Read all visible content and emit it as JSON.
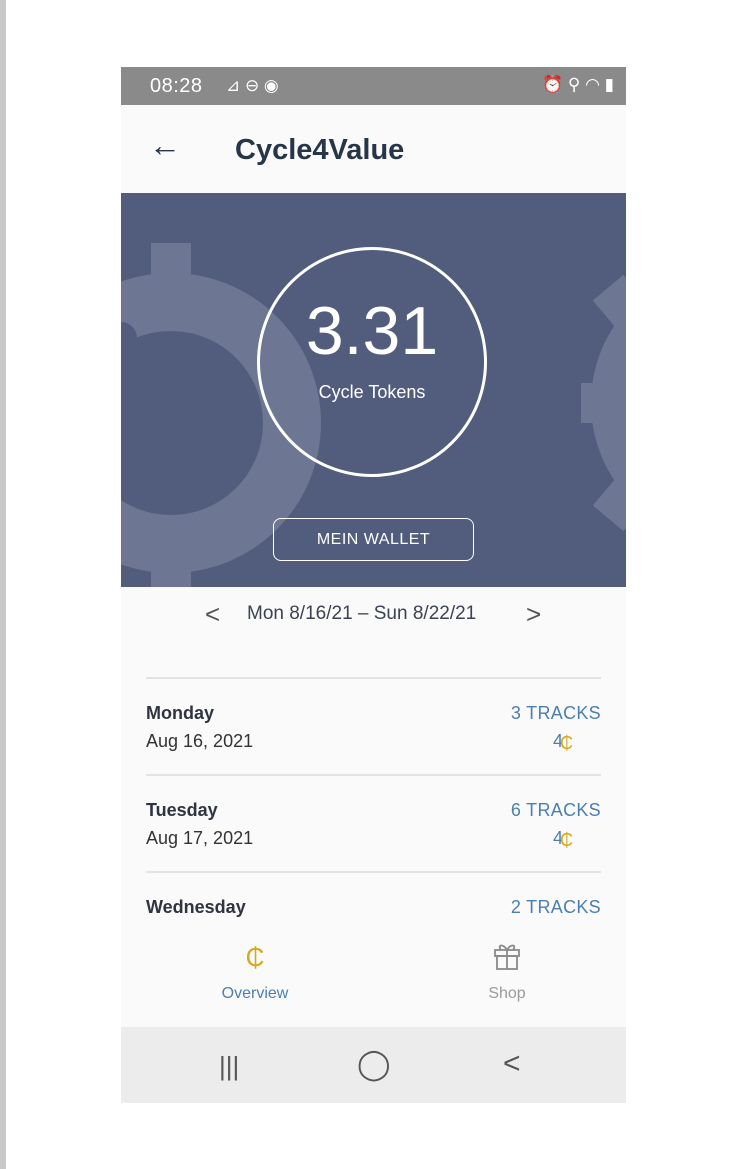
{
  "status_bar": {
    "time": "08:28",
    "left_icons": "⊿ ⊖ ◉",
    "right_icons": "⏰ ⚲ ◠ ▮"
  },
  "app_bar": {
    "title": "Cycle4Value",
    "back_icon": "arrow-left-icon"
  },
  "hero": {
    "token_value": "3.31",
    "token_label": "Cycle Tokens",
    "wallet_button": "MEIN WALLET",
    "background_color": "#525d7d"
  },
  "week_nav": {
    "prev": "<",
    "range": "Mon 8/16/21 – Sun 8/22/21",
    "next": ">"
  },
  "days": [
    {
      "name": "Monday",
      "date": "Aug 16, 2021",
      "tracks": "3 TRACKS",
      "tokens": "4"
    },
    {
      "name": "Tuesday",
      "date": "Aug 17, 2021",
      "tracks": "6 TRACKS",
      "tokens": "4"
    },
    {
      "name": "Wednesday",
      "date": "",
      "tracks": "2 TRACKS",
      "tokens": ""
    }
  ],
  "coin_symbol": "₵",
  "tabs": {
    "overview": {
      "label": "Overview",
      "icon": "₵",
      "active_color": "#4a7fb0"
    },
    "shop": {
      "label": "Shop",
      "icon": "gift-icon",
      "color": "#9a9a9a"
    }
  },
  "nav_bar": {
    "recents": "|||",
    "home": "◯",
    "back": "<"
  }
}
